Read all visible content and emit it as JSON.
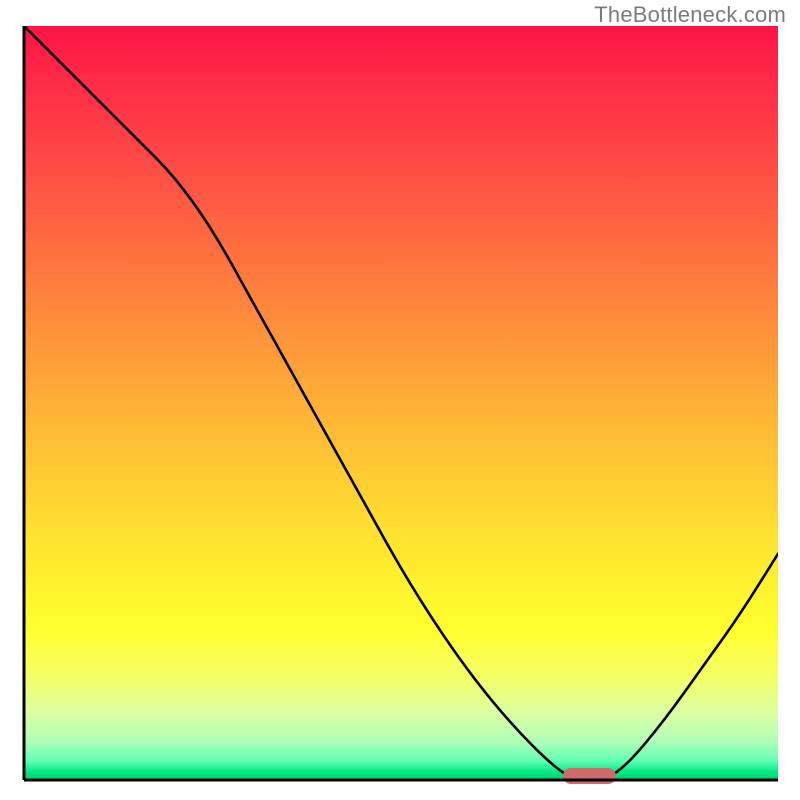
{
  "watermark": "TheBottleneck.com",
  "colors": {
    "watermark": "#7b7b7b",
    "axis": "#000000",
    "curve": "#000000",
    "marker": "#cf6a6a",
    "gradient_top": "#ff1446",
    "gradient_bottom": "#00d46e"
  },
  "chart_data": {
    "type": "line",
    "title": "",
    "xlabel": "",
    "ylabel": "",
    "xlim": [
      0,
      100
    ],
    "ylim": [
      0,
      100
    ],
    "grid": false,
    "x": [
      0,
      5,
      10,
      15,
      20,
      25,
      30,
      35,
      40,
      45,
      50,
      55,
      60,
      65,
      70,
      73,
      77,
      80,
      85,
      90,
      95,
      100
    ],
    "values": [
      100,
      95,
      90,
      85,
      80,
      73,
      64,
      55,
      46,
      37,
      28,
      20,
      13,
      7,
      2,
      0,
      0,
      2,
      8,
      15,
      22,
      30
    ],
    "marker": {
      "x": 75,
      "y": 0,
      "width": 7,
      "color": "#cf6a6a"
    },
    "annotations": []
  }
}
